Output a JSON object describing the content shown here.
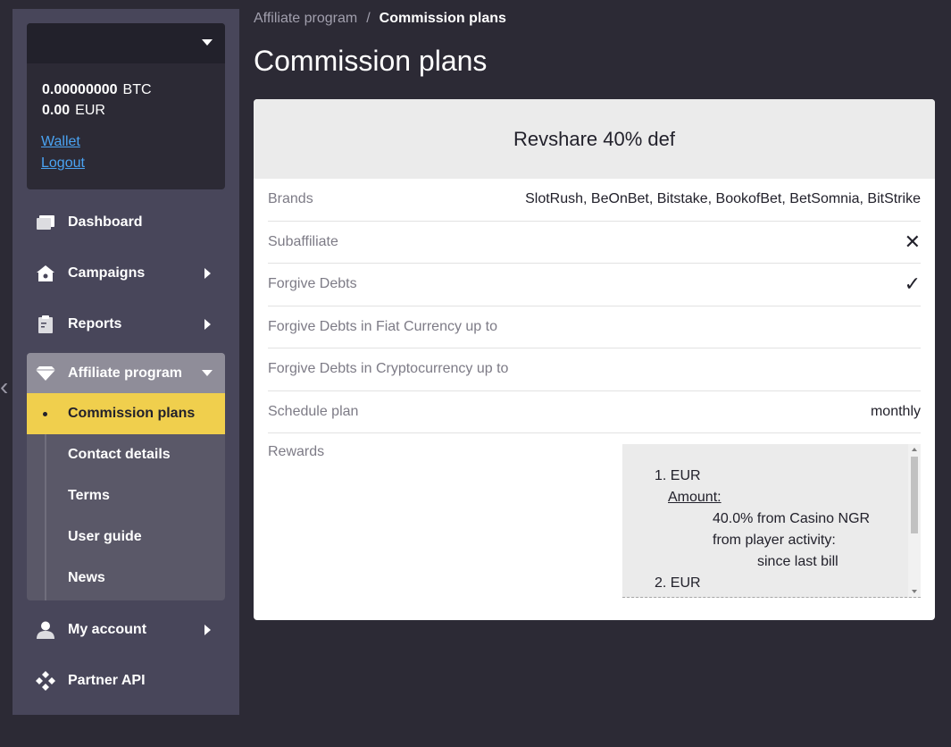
{
  "account": {
    "selected": "",
    "balances": [
      {
        "amount": "0.00000000",
        "currency": "BTC"
      },
      {
        "amount": "0.00",
        "currency": "EUR"
      }
    ],
    "wallet_link": "Wallet",
    "logout_link": "Logout"
  },
  "nav": {
    "dashboard": "Dashboard",
    "campaigns": "Campaigns",
    "reports": "Reports",
    "affiliate_program": "Affiliate program",
    "sub_items": [
      "Commission plans",
      "Contact details",
      "Terms",
      "User guide",
      "News"
    ],
    "my_account": "My account",
    "partner_api": "Partner API"
  },
  "breadcrumb": {
    "parent": "Affiliate program",
    "separator": "/",
    "current": "Commission plans"
  },
  "page_title": "Commission plans",
  "plan": {
    "title": "Revshare 40% def",
    "rows": [
      {
        "label": "Brands",
        "value": "SlotRush, BeOnBet, Bitstake, BookofBet, BetSomnia, BitStrike"
      },
      {
        "label": "Subaffiliate",
        "value": "✕"
      },
      {
        "label": "Forgive Debts",
        "value": "✓"
      },
      {
        "label": "Forgive Debts in Fiat Currency up to",
        "value": ""
      },
      {
        "label": "Forgive Debts in Cryptocurrency up to",
        "value": ""
      },
      {
        "label": "Schedule plan",
        "value": "monthly"
      }
    ],
    "rewards_label": "Rewards",
    "rewards": {
      "item1": "1. EUR",
      "amount_label": "Amount:",
      "line1": "40.0% from Casino NGR",
      "line2": "from player activity:",
      "line3": "since last bill",
      "item2": "2. EUR"
    }
  }
}
